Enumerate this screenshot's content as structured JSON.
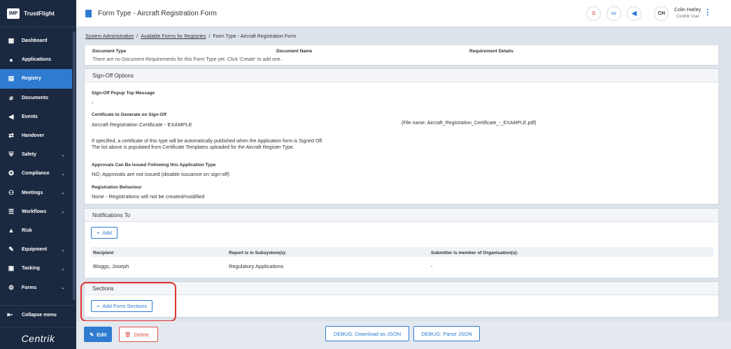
{
  "brand": {
    "logo": "IMP",
    "name": "TrustFlight"
  },
  "sidebar": {
    "items": [
      {
        "label": "Dashboard",
        "icon": "grid-icon",
        "glyph": "▦",
        "chevron": false
      },
      {
        "label": "Applications",
        "icon": "person-icon",
        "glyph": "●",
        "chevron": false
      },
      {
        "label": "Registry",
        "icon": "book-icon",
        "glyph": "▤",
        "chevron": false,
        "active": true
      },
      {
        "label": "Documents",
        "icon": "paperclip-icon",
        "glyph": "⌀",
        "chevron": false
      },
      {
        "label": "Events",
        "icon": "megaphone-icon",
        "glyph": "◀",
        "chevron": false
      },
      {
        "label": "Handover",
        "icon": "handover-icon",
        "glyph": "⇄",
        "chevron": false
      },
      {
        "label": "Safety",
        "icon": "safety-icon",
        "glyph": "⛨",
        "chevron": true
      },
      {
        "label": "Compliance",
        "icon": "compliance-icon",
        "glyph": "✪",
        "chevron": true
      },
      {
        "label": "Meetings",
        "icon": "meetings-icon",
        "glyph": "⚇",
        "chevron": true
      },
      {
        "label": "Workflows",
        "icon": "workflows-icon",
        "glyph": "☰",
        "chevron": true
      },
      {
        "label": "Risk",
        "icon": "risk-icon",
        "glyph": "▲",
        "chevron": false
      },
      {
        "label": "Equipment",
        "icon": "wrench-icon",
        "glyph": "✎",
        "chevron": true
      },
      {
        "label": "Tasking",
        "icon": "tasking-icon",
        "glyph": "▣",
        "chevron": true
      },
      {
        "label": "Forms",
        "icon": "forms-icon",
        "glyph": "⚙",
        "chevron": true
      }
    ],
    "collapse_label": "Collapse menu",
    "footer_logo": "Centrik"
  },
  "header": {
    "title": "Form Type - Aircraft Registration Form",
    "user_initials": "CH",
    "user_name": "Colin Harley",
    "user_role": "Centrik User"
  },
  "breadcrumb": {
    "items": [
      "System Administration",
      "Available Forms for Registries",
      "Form Type - Aircraft Registration Form"
    ],
    "separator": "/"
  },
  "documents": {
    "columns": [
      "Document Type",
      "Document Name",
      "Requirement Details"
    ],
    "empty_text": "There are no Document Requirements for this Form Type yet. Click 'Create' to add one.."
  },
  "signoff": {
    "title": "Sign-Off Options",
    "popup_label": "Sign-Off Popup Top Message",
    "popup_value": "-",
    "cert_label": "Certificate to Generate on Sign-Off",
    "cert_value": "Aircraft Registration Certificate - EXAMPLE",
    "cert_file": "(File name: Aircraft_Registration_Certificate_-_EXAMPLE.pdf)",
    "cert_note_1": "If specified, a certificate of this type will be automatically published when the Application form is Signed Off.",
    "cert_note_2": "The list above is populated from Certificate Templates uploaded for the Aircraft Register Type.",
    "approvals_label": "Approvals Can Be Issued Following this Application Type",
    "approvals_value": "NO, Approvals are not issued (disable issuance on sign-off)",
    "reg_label": "Registration Behaviour",
    "reg_value": "None - Registrations will not be created/modified"
  },
  "notifications": {
    "title": "Notifications To",
    "add_label": "Add",
    "columns": [
      "Recipient",
      "Report is in Subsystem(s):",
      "Submitter is member of Organisation(s):"
    ],
    "rows": [
      [
        "Bloggs, Joseph",
        "Regulatory Applications",
        "-"
      ]
    ]
  },
  "sections": {
    "title": "Sections",
    "add_label": "Add Form Sections"
  },
  "actions": {
    "edit": "Edit",
    "delete": "Delete",
    "debug_download": "DEBUG: Download as JSON",
    "debug_parse": "DEBUG: Parse JSON"
  },
  "colors": {
    "accent": "#2e7bd1",
    "sidebar": "#1b2940",
    "danger": "#d9534f",
    "highlight": "#e03131"
  }
}
